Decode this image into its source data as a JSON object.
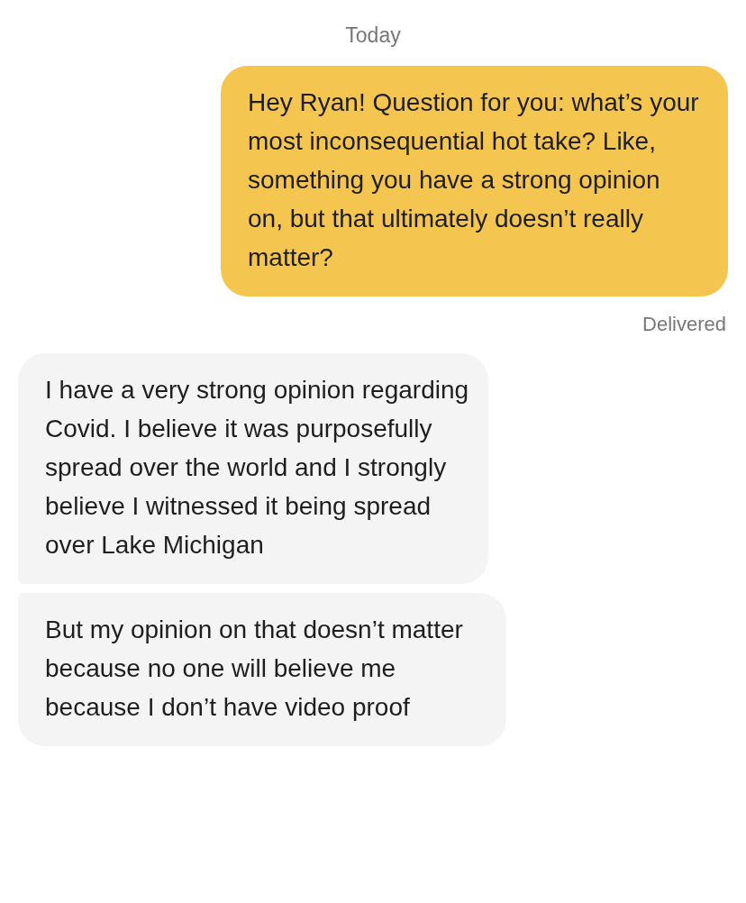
{
  "date_label": "Today",
  "messages": [
    {
      "kind": "sent",
      "text": "Hey Ryan! Question for you: what’s your most inconsequential hot take? Like, something you have a strong opinion on, but that ultimately doesn’t really matter?",
      "status": "Delivered"
    },
    {
      "kind": "received",
      "text": "I have a very strong opinion regarding Covid. I believe it was purposefully spread over the world and I strongly believe I witnessed it being spread over Lake Michigan"
    },
    {
      "kind": "received",
      "text": "But my opinion on that doesn’t matter because no one will believe me because I don’t have video proof"
    }
  ]
}
